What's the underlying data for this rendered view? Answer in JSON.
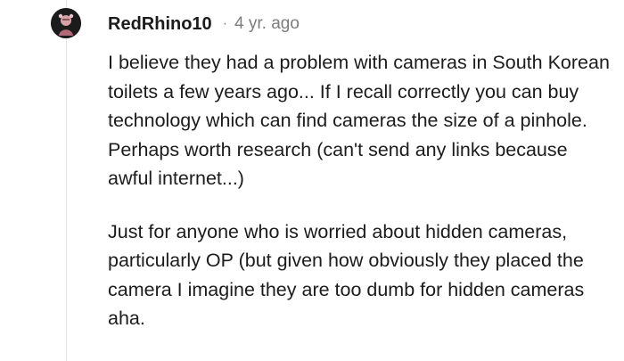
{
  "comment": {
    "author": "RedRhino10",
    "separator": "·",
    "timestamp": "4 yr. ago",
    "avatar_icon": "user-avatar-icon",
    "paragraphs": [
      "I believe they had a problem with cameras in South Korean toilets a few years ago... If I recall correctly you can buy technology which can find cameras the size of a pinhole. Perhaps worth research (can't send any links because awful internet...)",
      "Just for anyone who is worried about hidden cameras, particularly OP (but given how obviously they placed the camera I imagine they are too dumb for hidden cameras aha."
    ]
  }
}
